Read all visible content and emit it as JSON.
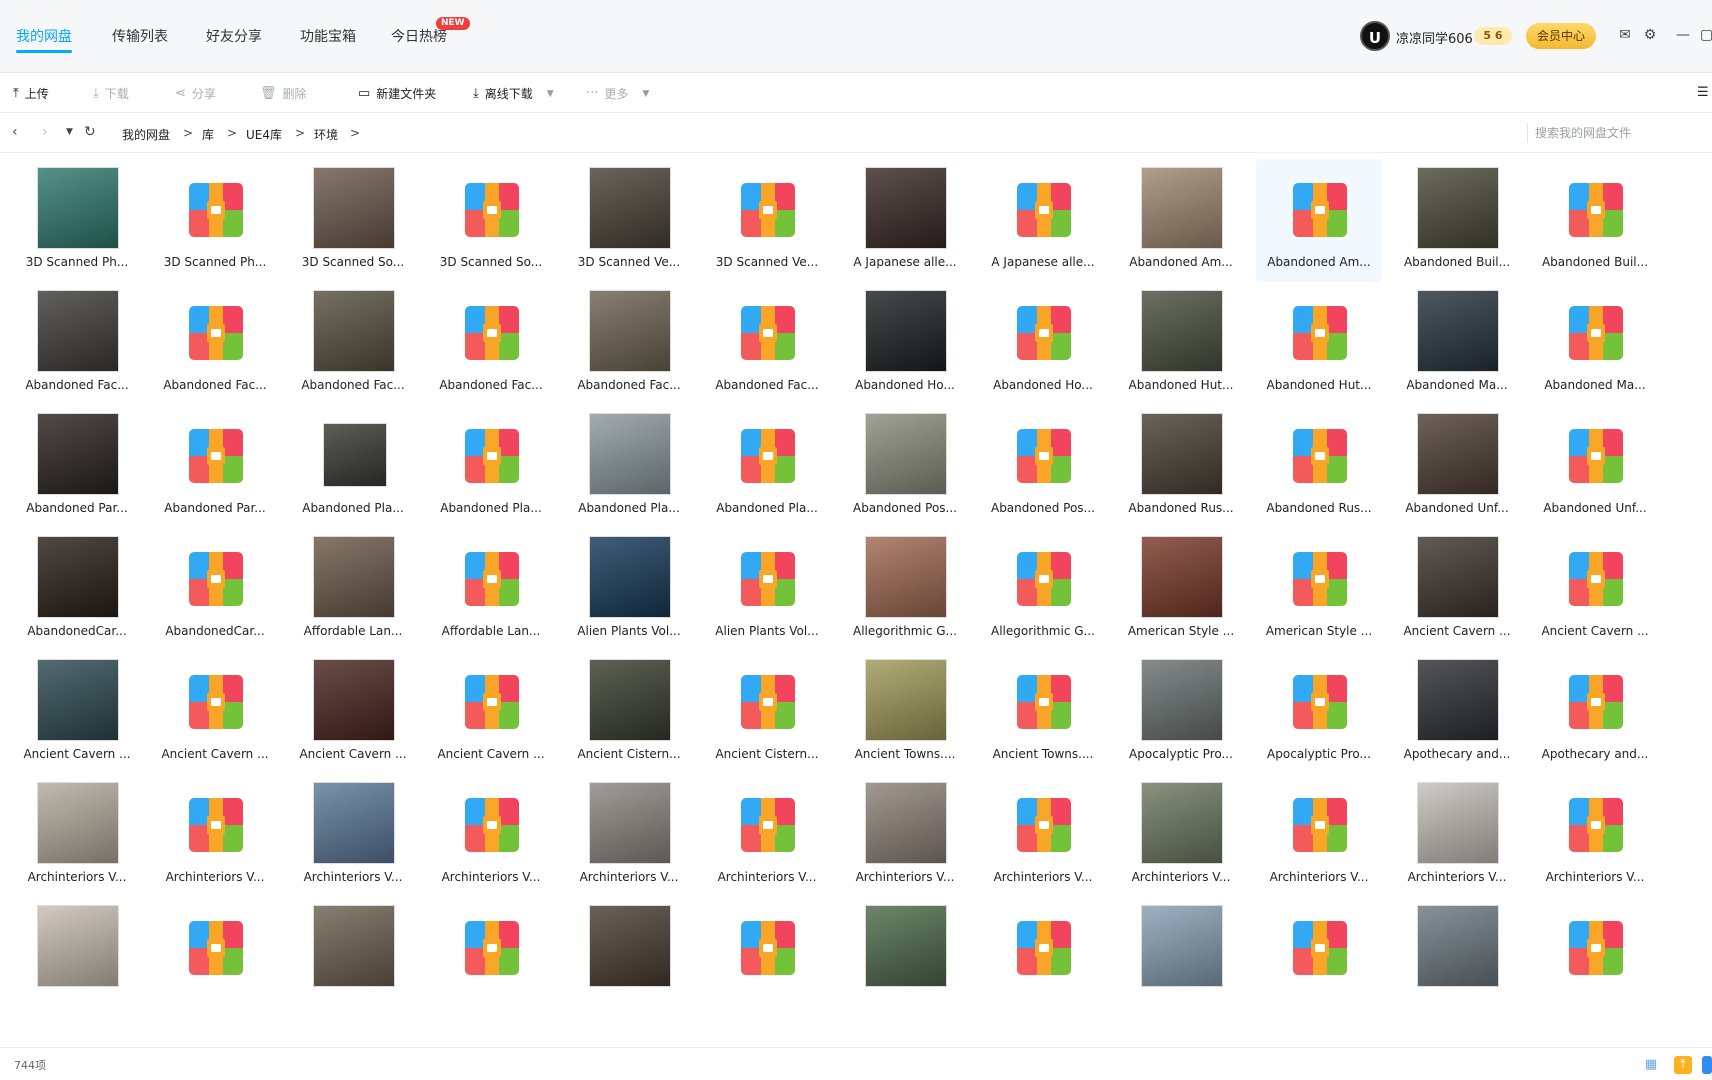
{
  "nav": {
    "tabs": [
      "我的网盘",
      "传输列表",
      "好友分享",
      "功能宝箱",
      "今日热榜"
    ],
    "new_badge": "NEW"
  },
  "user": {
    "avatar_letter": "U",
    "name": "凉凉同学606",
    "level": "5 6",
    "vip_label": "会员中心"
  },
  "toolbar": {
    "upload": "上传",
    "download": "下载",
    "share": "分享",
    "delete": "删除",
    "new_folder": "新建文件夹",
    "offline_download": "离线下载",
    "more": "更多"
  },
  "breadcrumb": [
    "我的网盘",
    "库",
    "UE4库",
    "环境"
  ],
  "search": {
    "placeholder": "搜索我的网盘文件"
  },
  "files": [
    {
      "name": "3D Scanned Ph...",
      "type": "image",
      "color": "#2f7a6e"
    },
    {
      "name": "3D Scanned Ph...",
      "type": "zip"
    },
    {
      "name": "3D Scanned So...",
      "type": "image",
      "color": "#6b5a4e"
    },
    {
      "name": "3D Scanned So...",
      "type": "zip"
    },
    {
      "name": "3D Scanned Ve...",
      "type": "image",
      "color": "#4a4238"
    },
    {
      "name": "3D Scanned Ve...",
      "type": "zip"
    },
    {
      "name": "A Japanese alle...",
      "type": "image",
      "color": "#3a2a28"
    },
    {
      "name": "A Japanese alle...",
      "type": "zip"
    },
    {
      "name": "Abandoned Am...",
      "type": "image",
      "color": "#a08972"
    },
    {
      "name": "Abandoned Am...",
      "type": "zip",
      "highlight": true
    },
    {
      "name": "Abandoned Buil...",
      "type": "image",
      "color": "#4a4a3a"
    },
    {
      "name": "Abandoned Buil...",
      "type": "zip"
    },
    {
      "name": "Abandoned Fac...",
      "type": "image",
      "color": "#3f3d3a"
    },
    {
      "name": "Abandoned Fac...",
      "type": "zip"
    },
    {
      "name": "Abandoned Fac...",
      "type": "image",
      "color": "#57513f"
    },
    {
      "name": "Abandoned Fac...",
      "type": "zip"
    },
    {
      "name": "Abandoned Fac...",
      "type": "image",
      "color": "#6e6452"
    },
    {
      "name": "Abandoned Fac...",
      "type": "zip"
    },
    {
      "name": "Abandoned Ho...",
      "type": "image",
      "color": "#1e2224"
    },
    {
      "name": "Abandoned Ho...",
      "type": "zip"
    },
    {
      "name": "Abandoned Hut...",
      "type": "image",
      "color": "#4c5140"
    },
    {
      "name": "Abandoned Hut...",
      "type": "zip"
    },
    {
      "name": "Abandoned Ma...",
      "type": "image",
      "color": "#28343f"
    },
    {
      "name": "Abandoned Ma...",
      "type": "zip"
    },
    {
      "name": "Abandoned Par...",
      "type": "image",
      "color": "#2a2420"
    },
    {
      "name": "Abandoned Par...",
      "type": "zip"
    },
    {
      "name": "Abandoned Pla...",
      "type": "image",
      "color": "#3a3a34",
      "small": true
    },
    {
      "name": "Abandoned Pla...",
      "type": "zip"
    },
    {
      "name": "Abandoned Pla...",
      "type": "image",
      "color": "#8d9aa0"
    },
    {
      "name": "Abandoned Pla...",
      "type": "zip"
    },
    {
      "name": "Abandoned Pos...",
      "type": "image",
      "color": "#8a8e7c"
    },
    {
      "name": "Abandoned Pos...",
      "type": "zip"
    },
    {
      "name": "Abandoned Rus...",
      "type": "image",
      "color": "#4a4136"
    },
    {
      "name": "Abandoned Rus...",
      "type": "zip"
    },
    {
      "name": "Abandoned Unf...",
      "type": "image",
      "color": "#4e3f35"
    },
    {
      "name": "Abandoned Unf...",
      "type": "zip"
    },
    {
      "name": "AbandonedCar...",
      "type": "image",
      "color": "#2a2018"
    },
    {
      "name": "AbandonedCar...",
      "type": "zip"
    },
    {
      "name": "Affordable Lan...",
      "type": "image",
      "color": "#6b5a4a"
    },
    {
      "name": "Affordable Lan...",
      "type": "zip"
    },
    {
      "name": "Alien Plants Vol...",
      "type": "image",
      "color": "#163b5a"
    },
    {
      "name": "Alien Plants Vol...",
      "type": "zip"
    },
    {
      "name": "Allegorithmic G...",
      "type": "image",
      "color": "#a06a52"
    },
    {
      "name": "Allegorithmic G...",
      "type": "zip"
    },
    {
      "name": "American Style ...",
      "type": "image",
      "color": "#7a3a2a"
    },
    {
      "name": "American Style ...",
      "type": "zip"
    },
    {
      "name": "Ancient Cavern ...",
      "type": "image",
      "color": "#3e3630"
    },
    {
      "name": "Ancient Cavern ...",
      "type": "zip"
    },
    {
      "name": "Ancient Cavern ...",
      "type": "image",
      "color": "#2e4a52"
    },
    {
      "name": "Ancient Cavern ...",
      "type": "zip"
    },
    {
      "name": "Ancient Cavern ...",
      "type": "image",
      "color": "#4a2620"
    },
    {
      "name": "Ancient Cavern ...",
      "type": "zip"
    },
    {
      "name": "Ancient Cistern...",
      "type": "image",
      "color": "#3a3e30"
    },
    {
      "name": "Ancient Cistern...",
      "type": "zip"
    },
    {
      "name": "Ancient Towns....",
      "type": "image",
      "color": "#a09a5a"
    },
    {
      "name": "Ancient Towns....",
      "type": "zip"
    },
    {
      "name": "Apocalyptic Pro...",
      "type": "image",
      "color": "#6a7270"
    },
    {
      "name": "Apocalyptic Pro...",
      "type": "zip"
    },
    {
      "name": "Apothecary and...",
      "type": "image",
      "color": "#2e3034"
    },
    {
      "name": "Apothecary and...",
      "type": "zip"
    },
    {
      "name": "Archinteriors V...",
      "type": "image",
      "color": "#b5ad9e"
    },
    {
      "name": "Archinteriors V...",
      "type": "zip"
    },
    {
      "name": "Archinteriors V...",
      "type": "image",
      "color": "#5c7a9a"
    },
    {
      "name": "Archinteriors V...",
      "type": "zip"
    },
    {
      "name": "Archinteriors V...",
      "type": "image",
      "color": "#8a8880"
    },
    {
      "name": "Archinteriors V...",
      "type": "zip"
    },
    {
      "name": "Archinteriors V...",
      "type": "image",
      "color": "#8e8278"
    },
    {
      "name": "Archinteriors V...",
      "type": "zip"
    },
    {
      "name": "Archinteriors V...",
      "type": "image",
      "color": "#6e7a60"
    },
    {
      "name": "Archinteriors V...",
      "type": "zip"
    },
    {
      "name": "Archinteriors V...",
      "type": "image",
      "color": "#c4c0ba"
    },
    {
      "name": "Archinteriors V...",
      "type": "zip"
    },
    {
      "name": "",
      "type": "image",
      "color": "#c9bfb3"
    },
    {
      "name": "",
      "type": "zip"
    },
    {
      "name": "",
      "type": "image",
      "color": "#6e6252"
    },
    {
      "name": "",
      "type": "zip"
    },
    {
      "name": "",
      "type": "image",
      "color": "#4a3e32"
    },
    {
      "name": "",
      "type": "zip"
    },
    {
      "name": "",
      "type": "image",
      "color": "#4e6a4a"
    },
    {
      "name": "",
      "type": "zip"
    },
    {
      "name": "",
      "type": "image",
      "color": "#8aa0b4"
    },
    {
      "name": "",
      "type": "zip"
    },
    {
      "name": "",
      "type": "image",
      "color": "#6e7a82"
    },
    {
      "name": "",
      "type": "zip"
    }
  ],
  "status": {
    "count": "744项"
  },
  "colors": {
    "accent": "#06a7ff",
    "vip": "#f3b92f"
  }
}
